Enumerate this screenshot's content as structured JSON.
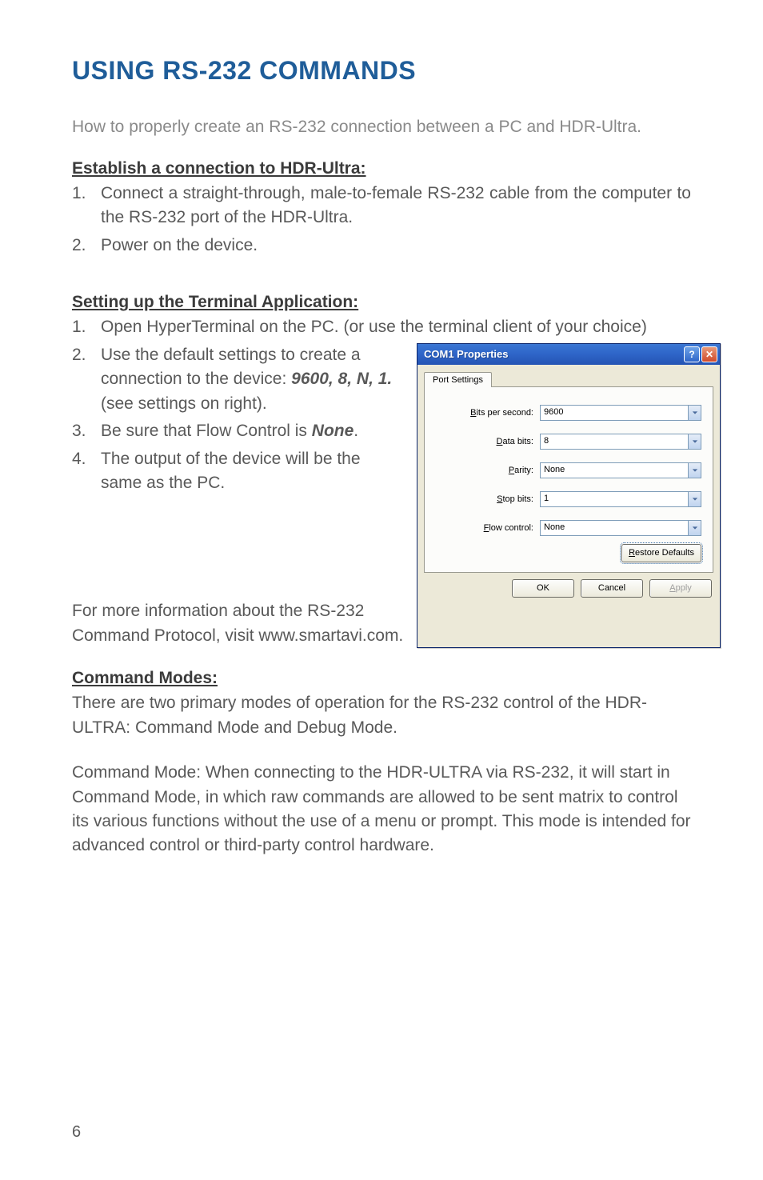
{
  "page": {
    "title": "USING RS-232 COMMANDS",
    "intro": "How to properly create an RS-232 connection between a PC and HDR-Ultra.",
    "page_number": "6"
  },
  "establish": {
    "heading": "Establish a connection to HDR-Ultra:",
    "items": [
      "Connect a straight-through, male-to-female RS-232 cable from the computer to the RS-232 port of the HDR-Ultra.",
      "Power on the device."
    ]
  },
  "terminal": {
    "heading": "Setting up the Terminal Application:",
    "items": [
      "Open HyperTerminal on the PC. (or use the terminal client of your choice)",
      {
        "pre": "Use the default settings to create a connection to the device: ",
        "bold": "9600, 8, N, 1.",
        "post": "(see settings on right)."
      },
      {
        "pre": "Be sure that Flow Control is ",
        "bold": "None",
        "post": "."
      },
      "The output of the device will be the same as the PC."
    ],
    "after": "For more information about the RS-232 Command Protocol, visit www.smartavi.com."
  },
  "dialog": {
    "title": "COM1 Properties",
    "tab": "Port Settings",
    "fields": {
      "bits_per_second": {
        "label_pre": "B",
        "label_rest": "its per second:",
        "value": "9600"
      },
      "data_bits": {
        "label_pre": "D",
        "label_rest": "ata bits:",
        "value": "8"
      },
      "parity": {
        "label_pre": "P",
        "label_rest": "arity:",
        "value": "None"
      },
      "stop_bits": {
        "label_pre": "S",
        "label_rest": "top bits:",
        "value": "1"
      },
      "flow_control": {
        "label_pre": "F",
        "label_rest": "low control:",
        "value": "None"
      }
    },
    "buttons": {
      "restore_pre": "R",
      "restore_rest": "estore Defaults",
      "ok": "OK",
      "cancel": "Cancel",
      "apply_pre": "A",
      "apply_rest": "pply"
    }
  },
  "command_modes": {
    "heading": "Command Modes:",
    "para1": "There are two primary modes of operation for the RS-232 control of the HDR-ULTRA: Command Mode and Debug Mode.",
    "para2": "Command Mode: When connecting to the HDR-ULTRA via RS-232, it will start in Command Mode, in which raw commands are allowed to be sent matrix to control its various functions without the use of a menu or prompt. This mode is intended for advanced control or third-party control hardware."
  }
}
